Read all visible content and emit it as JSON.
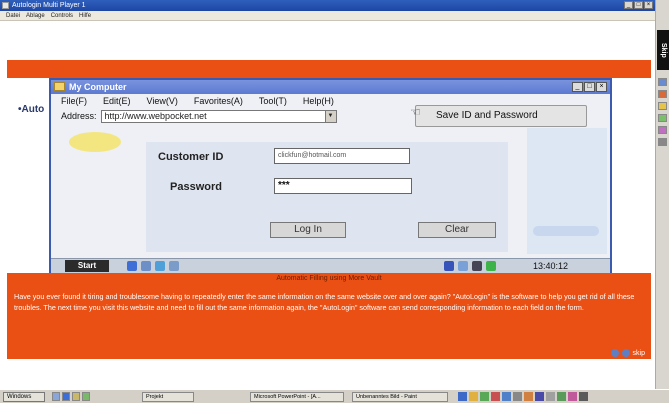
{
  "outer_window": {
    "title": "Autologin Multi Player 1",
    "menu": [
      "Datei",
      "Ablage",
      "Controls",
      "Hilfe"
    ]
  },
  "side_tab": "Skip",
  "left_label": "•Auto",
  "inner_window": {
    "title": "My Computer",
    "menu": [
      "File(F)",
      "Edit(E)",
      "View(V)",
      "Favorites(A)",
      "Tool(T)",
      "Help(H)"
    ],
    "address_label": "Address:",
    "address_value": "http://www.webpocket.net",
    "save_button": "Save ID and Password"
  },
  "login": {
    "customer_id_label": "Customer ID",
    "customer_id_value": "clickfun@hotmail.com",
    "password_label": "Password",
    "password_value": "***",
    "login_button": "Log In",
    "clear_button": "Clear"
  },
  "inner_taskbar": {
    "start_label": "Start",
    "clock": "13:40:12"
  },
  "caption": {
    "heading": "Automatic Filling using More Vault",
    "body": "Have you ever found it tiring and troublesome having to repeatedly enter the same information on the same website over and over again? \"AutoLogin\" is the software to help you get rid of all these troubles. The next time you visit this website and need to fill out the same information again, the \"AutoLogin\" software can send corresponding information to each field on the form.",
    "skip_label": "skip"
  },
  "os_taskbar": {
    "start": "Windows",
    "buttons": [
      "Projekt",
      "Microsoft PowerPoint - [A...",
      "Unbenanntes Bild - Paint"
    ]
  },
  "colors": {
    "orange": "#ea4f13",
    "window_blue": "#3a5bb0"
  }
}
